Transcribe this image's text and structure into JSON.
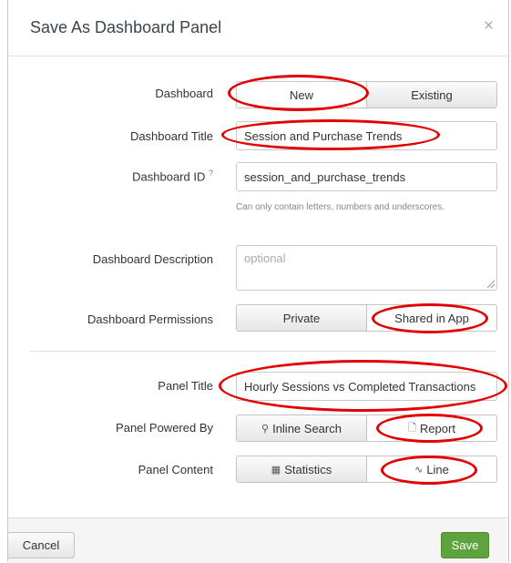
{
  "dialog": {
    "title": "Save As Dashboard Panel",
    "close_glyph": "×"
  },
  "dashboard": {
    "label": "Dashboard",
    "options": [
      "New",
      "Existing"
    ],
    "selected": "New"
  },
  "dashboard_title": {
    "label": "Dashboard Title",
    "value": "Session and Purchase Trends"
  },
  "dashboard_id": {
    "label": "Dashboard ID",
    "help_marker": "?",
    "value": "session_and_purchase_trends",
    "hint": "Can only contain letters, numbers and underscores."
  },
  "dashboard_description": {
    "label": "Dashboard Description",
    "placeholder": "optional"
  },
  "dashboard_permissions": {
    "label": "Dashboard Permissions",
    "options": [
      "Private",
      "Shared in App"
    ],
    "selected": "Shared in App"
  },
  "panel_title": {
    "label": "Panel Title",
    "value": "Hourly Sessions vs Completed Transactions"
  },
  "panel_powered_by": {
    "label": "Panel Powered By",
    "options": [
      {
        "label": "Inline Search",
        "icon": "search-icon"
      },
      {
        "label": "Report",
        "icon": "document-icon"
      }
    ],
    "selected": "Report"
  },
  "panel_content": {
    "label": "Panel Content",
    "options": [
      {
        "label": "Statistics",
        "icon": "table-icon"
      },
      {
        "label": "Line",
        "icon": "line-chart-icon"
      }
    ],
    "selected": "Line"
  },
  "footer": {
    "cancel_label": "Cancel",
    "save_label": "Save"
  },
  "annotation_color": "#e20000"
}
